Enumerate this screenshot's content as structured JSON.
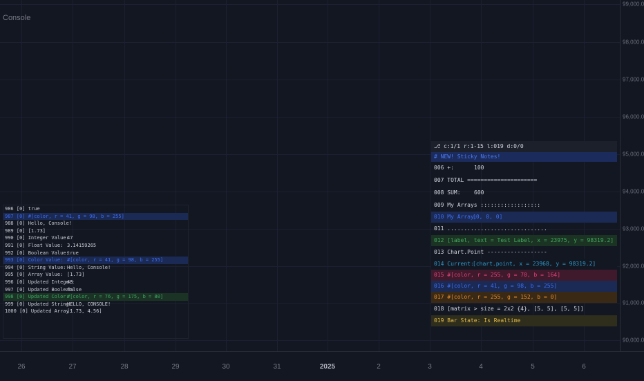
{
  "console_title": "Console",
  "price_axis": {
    "labels": [
      "99,000.0",
      "98,000.0",
      "97,000.0",
      "96,000.0",
      "95,000.0",
      "94,000.0",
      "93,000.0",
      "92,000.0",
      "91,000.0",
      "90,000.0"
    ]
  },
  "time_axis": {
    "labels": [
      "26",
      "27",
      "28",
      "29",
      "30",
      "31",
      "2025",
      "2",
      "3",
      "4",
      "5",
      "6"
    ]
  },
  "log": {
    "rows": [
      {
        "c1": "986 [0] true",
        "c2": ""
      },
      {
        "c1": "987 [0] #[color, r = 41, g = 98, b = 255]",
        "c2": ""
      },
      {
        "c1": "988 [0] Hello, Console!",
        "c2": ""
      },
      {
        "c1": "989 [0] [1.73]",
        "c2": ""
      },
      {
        "c1": "990 [0] Integer Value:",
        "c2": "47"
      },
      {
        "c1": "991 [0] Float Value:",
        "c2": "3.14159265"
      },
      {
        "c1": "992 [0] Boolean Value:",
        "c2": "true"
      },
      {
        "c1": "993 [0] Color Value:",
        "c2": "#[color, r = 41, g = 98, b = 255]"
      },
      {
        "c1": "994 [0] String Value:",
        "c2": "Hello, Console!"
      },
      {
        "c1": "995 [0] Array Value:",
        "c2": "[1.73]"
      },
      {
        "c1": "996 [0] Updated Integer:",
        "c2": "43"
      },
      {
        "c1": "997 [0] Updated Boolean:",
        "c2": "false"
      },
      {
        "c1": "998 [0] Updated Color:",
        "c2": "#[color, r = 76, g = 175, b = 80]"
      },
      {
        "c1": "999 [0] Updated String:",
        "c2": "HELLO, CONSOLE!"
      },
      {
        "c1": "1000 [0] Updated Array:",
        "c2": "[1.73, 4.56]"
      }
    ]
  },
  "sticky": {
    "rows": [
      {
        "c1": "⎇ c:1/1 r:1-15 l:019 d:0/0",
        "c2": ""
      },
      {
        "c1": "# NEW! Sticky Notes!",
        "c2": ""
      },
      {
        "c1": "006 +:",
        "c2": "100"
      },
      {
        "c1": "007 TOTAL =====================",
        "c2": ""
      },
      {
        "c1": "008 SUM:",
        "c2": "600"
      },
      {
        "c1": "009 My Arrays ::::::::::::::::::",
        "c2": ""
      },
      {
        "c1": "010 My Array:",
        "c2": "[0, 0, 0]"
      },
      {
        "c1": "011 ..............................",
        "c2": ""
      },
      {
        "c1": "012 [label, text = Test Label, x = 23975, y = 98319.2]",
        "c2": ""
      },
      {
        "c1": "013 Chart.Point ------------------",
        "c2": ""
      },
      {
        "c1": "014 Current:",
        "c2": "[chart.point, x = 23968, y = 98319.2]"
      },
      {
        "c1": "015 #[color, r = 255, g = 70, b = 164]",
        "c2": ""
      },
      {
        "c1": "016 #[color, r = 41, g = 98, b = 255]",
        "c2": ""
      },
      {
        "c1": "017 #[color, r = 255, g = 152, b = 0]",
        "c2": ""
      },
      {
        "c1": "018 [matrix > size = 2x2 {4}, [5, 5], [5, 5]]",
        "c2": ""
      },
      {
        "c1": "019 Bar State: Is Realtime",
        "c2": ""
      }
    ]
  }
}
